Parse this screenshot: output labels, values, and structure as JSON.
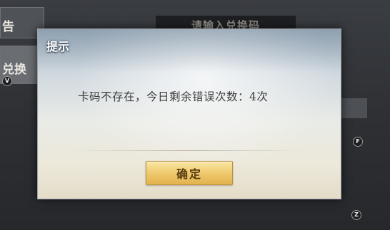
{
  "background": {
    "tab_top_label": "告",
    "tab_exchange_label": "兑换",
    "code_input_placeholder": "请输入兑换码",
    "key_hints": [
      "V",
      "F",
      "Z"
    ]
  },
  "dialog": {
    "title": "提示",
    "message": "卡码不存在，今日剩余错误次数：4次",
    "confirm_label": "确定"
  }
}
